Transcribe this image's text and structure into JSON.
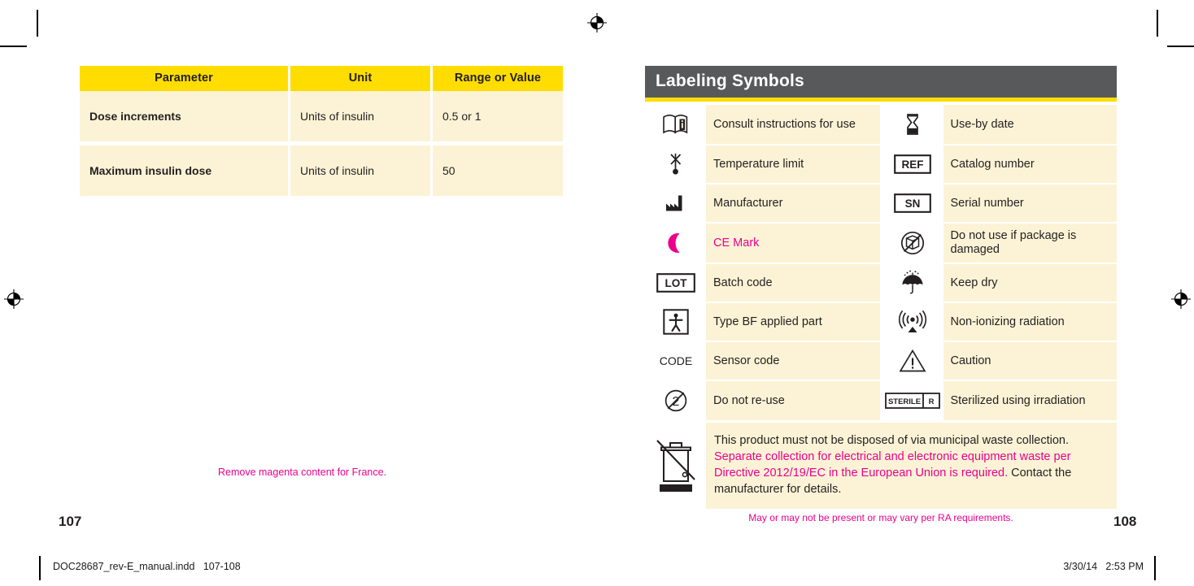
{
  "printer_marks": {
    "registration_icon": "registration-target-icon",
    "crop_mark": "crop-mark"
  },
  "slug": {
    "file_label": "DOC28687_rev-E_manual.indd   107-108",
    "date_label": "3/30/14   2:53 PM"
  },
  "left_page": {
    "folio": "107",
    "table": {
      "headers": [
        "Parameter",
        "Unit",
        "Range or Value"
      ],
      "rows": [
        {
          "parameter": "Dose increments",
          "unit": "Units of insulin",
          "range": "0.5 or 1"
        },
        {
          "parameter": "Maximum  insulin dose",
          "unit": "Units of insulin",
          "range": "50"
        }
      ]
    },
    "production_note": "Remove magenta content for France."
  },
  "right_page": {
    "folio": "108",
    "panel_title": "Labeling Symbols",
    "symbol_rows": [
      {
        "left": {
          "icon": "consult-instructions-icon",
          "label": "Consult instructions  for use",
          "magenta": false
        },
        "right": {
          "icon": "use-by-date-hourglass-icon",
          "label": "Use-by date",
          "magenta": false
        }
      },
      {
        "left": {
          "icon": "temperature-limit-icon",
          "label": "Temperature limit",
          "magenta": false
        },
        "right": {
          "icon": "ref-catalog-number-icon",
          "label": "Catalog number",
          "magenta": false
        }
      },
      {
        "left": {
          "icon": "manufacturer-factory-icon",
          "label": "Manufacturer",
          "magenta": false
        },
        "right": {
          "icon": "sn-serial-number-icon",
          "label": "Serial number",
          "magenta": false
        }
      },
      {
        "left": {
          "icon": "ce-mark-icon",
          "label": "CE Mark",
          "magenta": true
        },
        "right": {
          "icon": "package-damaged-icon",
          "label": "Do not use if package is damaged",
          "magenta": false
        }
      },
      {
        "left": {
          "icon": "lot-batch-code-icon",
          "label": "Batch code",
          "magenta": false
        },
        "right": {
          "icon": "keep-dry-umbrella-icon",
          "label": "Keep dry",
          "magenta": false
        }
      },
      {
        "left": {
          "icon": "type-bf-applied-part-icon",
          "label": "Type  BF applied part",
          "magenta": false
        },
        "right": {
          "icon": "non-ionizing-radiation-icon",
          "label": "Non-ionizing radiation",
          "magenta": false
        }
      },
      {
        "left": {
          "icon": "sensor-code-icon",
          "label": "Sensor code",
          "magenta": false
        },
        "right": {
          "icon": "caution-triangle-icon",
          "label": "Caution",
          "magenta": false
        }
      },
      {
        "left": {
          "icon": "do-not-reuse-icon",
          "label": "Do not re-use",
          "magenta": false
        },
        "right": {
          "icon": "sterile-r-irradiation-icon",
          "label": "Sterilized using irradiation",
          "magenta": false
        }
      }
    ],
    "sensor_code_glyph_text": "CODE",
    "weee": {
      "icon": "weee-crossed-bin-icon",
      "segments": [
        {
          "text": "This product must not be disposed of via municipal  waste collection.",
          "magenta": false
        },
        {
          "text": " Separate collection for electrical and electronic equipment waste per Directive  2012/19/EC in the European Union  is required.",
          "magenta": true
        },
        {
          "text": " Contact the manufacturer for details.",
          "magenta": false
        }
      ]
    },
    "production_note": "May or may not be present or may  vary  per  RA requirements."
  }
}
